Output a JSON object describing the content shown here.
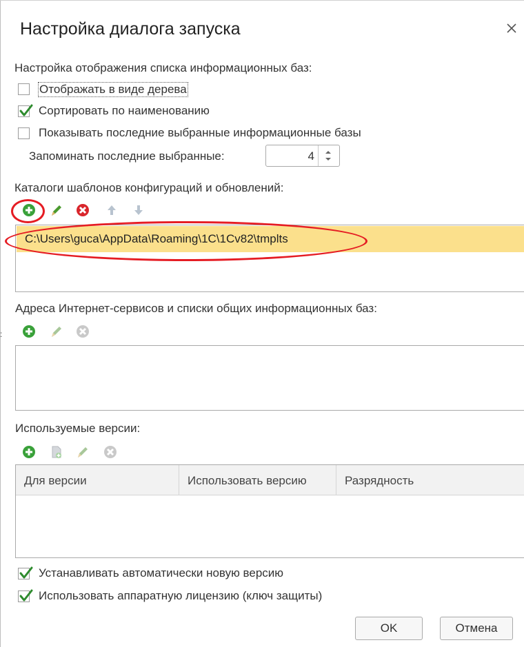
{
  "dialog": {
    "title": "Настройка диалога запуска"
  },
  "display_settings": {
    "heading": "Настройка отображения списка информационных баз:",
    "show_as_tree": {
      "label": "Отображать в виде дерева",
      "checked": false
    },
    "sort_by_name": {
      "label": "Сортировать по наименованию",
      "checked": true
    },
    "show_recent": {
      "label": "Показывать последние выбранные информационные базы",
      "checked": false
    },
    "remember_recent": {
      "label": "Запоминать последние выбранные:",
      "value": "4"
    }
  },
  "templates": {
    "heading": "Каталоги шаблонов конфигураций и обновлений:",
    "toolbar": [
      "add-icon",
      "edit-icon",
      "delete-icon",
      "move-up-icon",
      "move-down-icon"
    ],
    "items": [
      "C:\\Users\\guca\\AppData\\Roaming\\1C\\1Cv82\\tmplts"
    ]
  },
  "internet_services": {
    "heading": "Адреса Интернет-сервисов и списки общих информационных баз:",
    "toolbar": [
      "add-icon",
      "edit-icon",
      "delete-icon"
    ]
  },
  "versions": {
    "heading": "Используемые версии:",
    "toolbar": [
      "add-icon",
      "copy-icon",
      "edit-icon",
      "delete-icon"
    ],
    "columns": [
      "Для версии",
      "Использовать версию",
      "Разрядность"
    ]
  },
  "options": {
    "auto_install": {
      "label": "Устанавливать автоматически новую версию",
      "checked": true
    },
    "hardware_license": {
      "label": "Использовать аппаратную лицензию (ключ защиты)",
      "checked": true
    }
  },
  "buttons": {
    "ok": "OK",
    "cancel": "Отмена"
  },
  "colors": {
    "selection": "#fbe08c",
    "annotation": "#e51c23",
    "add_green": "#3aa13a",
    "delete_red": "#d9262c"
  }
}
